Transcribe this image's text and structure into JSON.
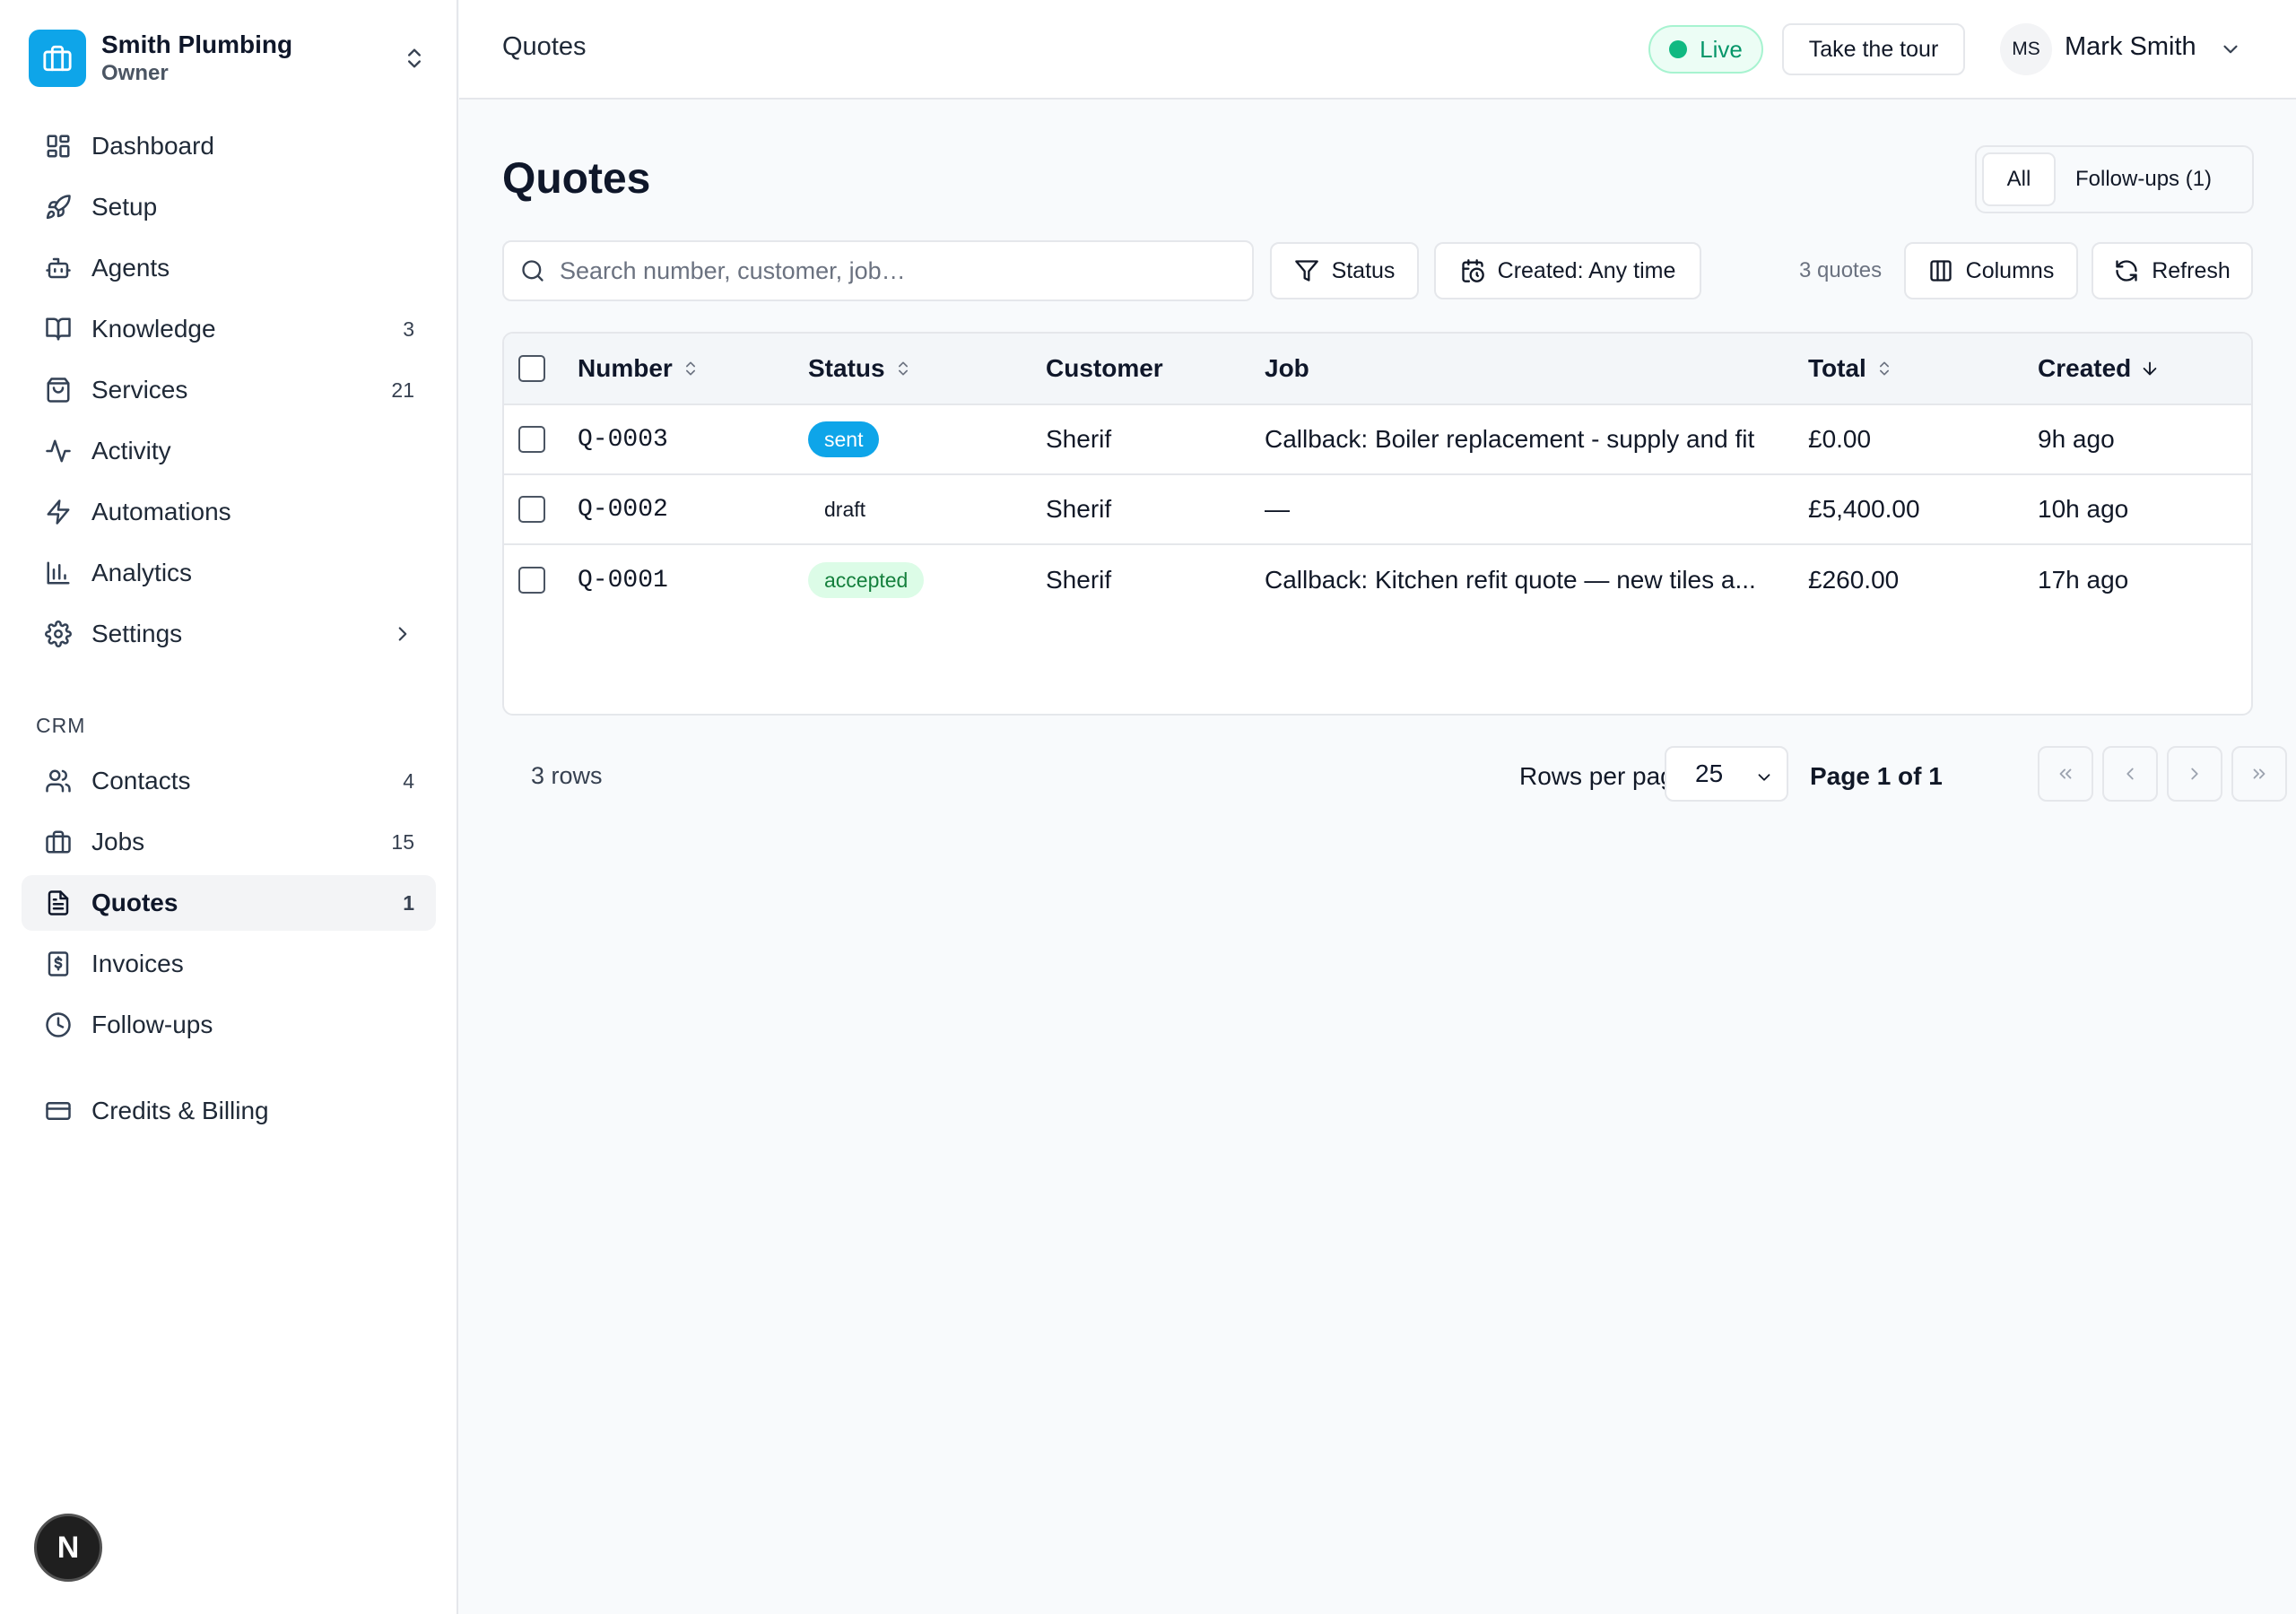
{
  "org": {
    "name": "Smith Plumbing",
    "role": "Owner"
  },
  "nav": [
    {
      "label": "Dashboard",
      "icon": "dashboard-icon",
      "count": ""
    },
    {
      "label": "Setup",
      "icon": "rocket-icon",
      "count": ""
    },
    {
      "label": "Agents",
      "icon": "bot-icon",
      "count": ""
    },
    {
      "label": "Knowledge",
      "icon": "book-icon",
      "count": "3"
    },
    {
      "label": "Services",
      "icon": "shopping-bag-icon",
      "count": "21"
    },
    {
      "label": "Activity",
      "icon": "activity-icon",
      "count": ""
    },
    {
      "label": "Automations",
      "icon": "bolt-icon",
      "count": ""
    },
    {
      "label": "Analytics",
      "icon": "bar-chart-icon",
      "count": ""
    },
    {
      "label": "Settings",
      "icon": "gear-icon",
      "count": ""
    }
  ],
  "crm_label": "CRM",
  "crm": [
    {
      "label": "Contacts",
      "icon": "users-icon",
      "count": "4"
    },
    {
      "label": "Jobs",
      "icon": "briefcase-icon",
      "count": "15"
    },
    {
      "label": "Quotes",
      "icon": "file-icon",
      "count": "1"
    },
    {
      "label": "Invoices",
      "icon": "receipt-icon",
      "count": ""
    },
    {
      "label": "Follow-ups",
      "icon": "clock-icon",
      "count": ""
    }
  ],
  "billing": {
    "label": "Credits & Billing",
    "icon": "credit-card-icon"
  },
  "dev_badge": "N",
  "topbar": {
    "breadcrumb": "Quotes",
    "live_label": "Live",
    "tour_label": "Take the tour",
    "user_initials": "MS",
    "user_name": "Mark Smith"
  },
  "page": {
    "title": "Quotes",
    "segments": {
      "all": "All",
      "followups": "Follow-ups (1)"
    },
    "search_placeholder": "Search number, customer, job…",
    "status_filter": "Status",
    "created_filter": "Created: Any time",
    "count_text": "3 quotes",
    "columns_label": "Columns",
    "refresh_label": "Refresh"
  },
  "table": {
    "headers": {
      "number": "Number",
      "status": "Status",
      "customer": "Customer",
      "job": "Job",
      "total": "Total",
      "created": "Created"
    },
    "rows": [
      {
        "number": "Q-0003",
        "status": "sent",
        "customer": "Sherif",
        "job": "Callback: Boiler replacement - supply and fit",
        "total": "£0.00",
        "created": "9h ago"
      },
      {
        "number": "Q-0002",
        "status": "draft",
        "customer": "Sherif",
        "job": "—",
        "total": "£5,400.00",
        "created": "10h ago"
      },
      {
        "number": "Q-0001",
        "status": "accepted",
        "customer": "Sherif",
        "job": "Callback: Kitchen refit quote — new tiles a...",
        "total": "£260.00",
        "created": "17h ago"
      }
    ]
  },
  "footer": {
    "rows_text": "3 rows",
    "rows_per_page_label": "Rows per page",
    "rows_per_page_value": "25",
    "page_text": "Page 1 of 1"
  },
  "colors": {
    "accent": "#0ea5e9",
    "live": "#10b981",
    "accepted_bg": "#dcfce7",
    "accepted_fg": "#15803d"
  }
}
